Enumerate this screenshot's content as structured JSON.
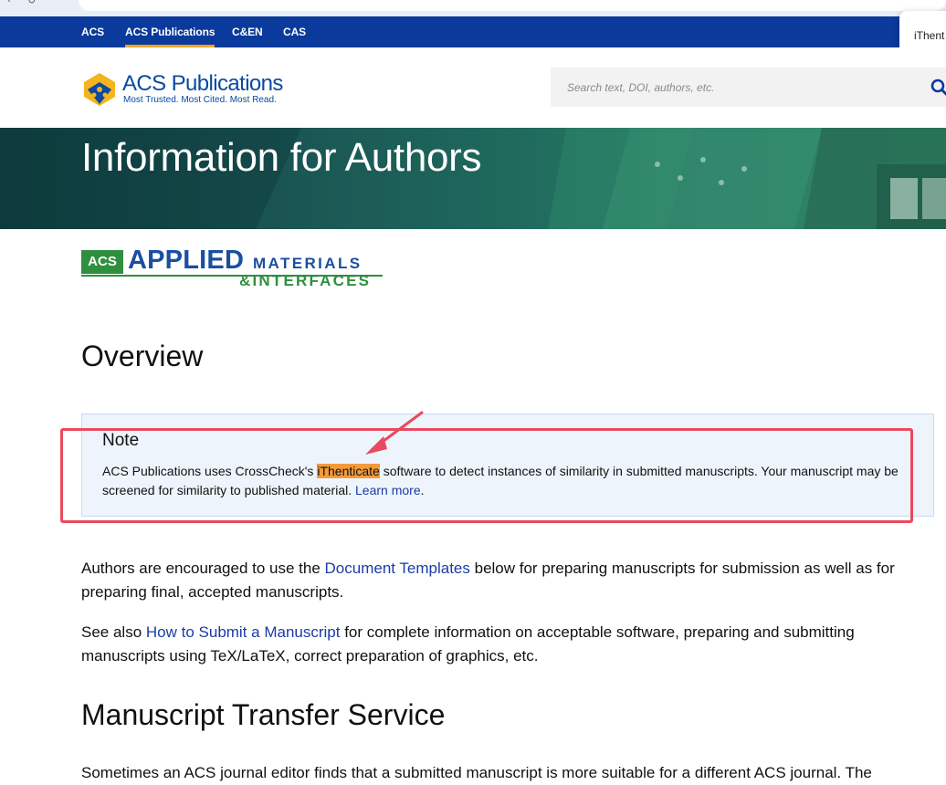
{
  "site_nav": {
    "items": [
      "ACS",
      "ACS Publications",
      "C&EN",
      "CAS"
    ],
    "active": "ACS Publications",
    "colors": {
      "bar": "#0a3a9c",
      "active_underline": "#f5a623"
    }
  },
  "popup": {
    "text": "iThent"
  },
  "header": {
    "logo_brand": "ACS Publications",
    "logo_tagline": "Most Trusted. Most Cited. Most Read.",
    "search_placeholder": "Search text, DOI, authors, etc.",
    "search_icon": "search-icon"
  },
  "hero": {
    "title": "Information for Authors"
  },
  "journal_logo": {
    "acs": "ACS",
    "applied": "APPLIED",
    "materials": "MATERIALS",
    "interfaces": "&INTERFACES"
  },
  "overview": {
    "heading": "Overview"
  },
  "note": {
    "title": "Note",
    "body_before": "ACS Publications uses CrossCheck's ",
    "highlight": "iThenticate",
    "body_after": " software to detect instances of similarity in submitted manuscripts. Your manuscript may be screened for similarity to published material. ",
    "link": "Learn more",
    "period": ".",
    "highlight_color": "#f39b3a",
    "annotation_color": "#e84a5f"
  },
  "para1": {
    "before": "Authors are encouraged to use the ",
    "link": "Document Templates",
    "after": " below for preparing manuscripts for submission as well as for preparing final, accepted manuscripts."
  },
  "para2": {
    "before": "See also ",
    "link": "How to Submit a Manuscript",
    "after": " for complete information on acceptable software, preparing and submitting manuscripts using TeX/LaTeX, correct preparation of graphics, etc."
  },
  "transfer": {
    "heading": "Manuscript Transfer Service"
  },
  "para3": {
    "text": "Sometimes an ACS journal editor finds that a submitted manuscript is more suitable for a different ACS journal. The"
  }
}
